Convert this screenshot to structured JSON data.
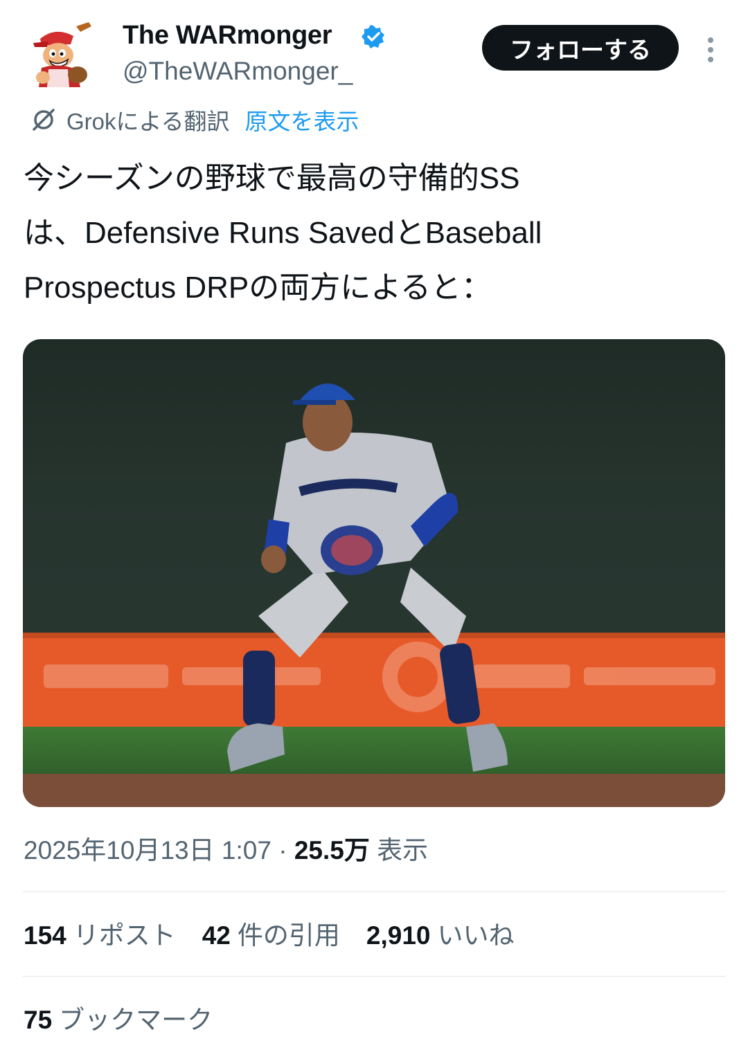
{
  "author": {
    "display_name": "The WARmonger",
    "handle": "@TheWARmonger_",
    "verified": true,
    "avatar_icon": "baseball-mascot-icon"
  },
  "follow_button": {
    "label": "フォローする"
  },
  "more_button": {
    "icon": "vertical-ellipsis-icon"
  },
  "translation": {
    "icon": "grok-icon",
    "label": "Grokによる翻訳",
    "show_original": "原文を表示"
  },
  "tweet": {
    "lines": [
      "今シーズンの野球で最高の守備的SS",
      "は、Defensive Runs SavedとBaseball",
      "Prospectus DRPの両方によると："
    ]
  },
  "meta": {
    "datetime": "2025年10月13日 1:07",
    "separator": "·",
    "views_count": "25.5万",
    "views_label": "表示"
  },
  "stats": {
    "reposts_count": "154",
    "reposts_label": "リポスト",
    "quotes_count": "42",
    "quotes_label": "件の引用",
    "likes_count": "2,910",
    "likes_label": "いいね",
    "bookmarks_count": "75",
    "bookmarks_label": "ブックマーク"
  },
  "colors": {
    "text_primary": "#0f1419",
    "text_secondary": "#536471",
    "link": "#1d9bf0",
    "verified": "#1d9bf0",
    "button_bg": "#0f1419"
  }
}
